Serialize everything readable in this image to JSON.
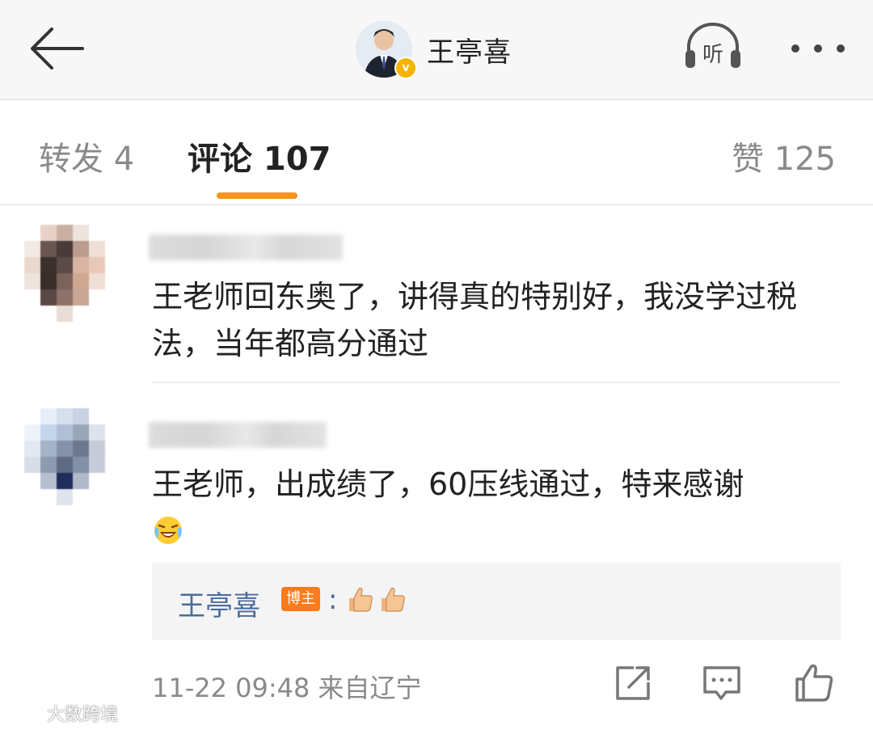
{
  "header": {
    "title": "王亭喜",
    "listen_label": "听"
  },
  "tabs": {
    "repost": "转发 4",
    "comment": "评论 107",
    "like": "赞 125"
  },
  "comments": [
    {
      "text": "王老师回东奥了，讲得真的特别好，我没学过税法，当年都高分通过"
    },
    {
      "text": "王老师，出成绩了，60压线通过，特来感谢",
      "emoji": "laugh-cry-emoji",
      "reply": {
        "author": "王亭喜",
        "badge": "博主",
        "separator": ":",
        "content_icons": [
          "thumbs-up-icon",
          "thumbs-up-icon"
        ]
      },
      "meta": "11-22 09:48 来自辽宁"
    }
  ],
  "watermark": "大数跨境",
  "colors": {
    "accent": "#f7941d",
    "link_blue": "#4a6c9b",
    "host_badge": "#ff7a1a"
  }
}
